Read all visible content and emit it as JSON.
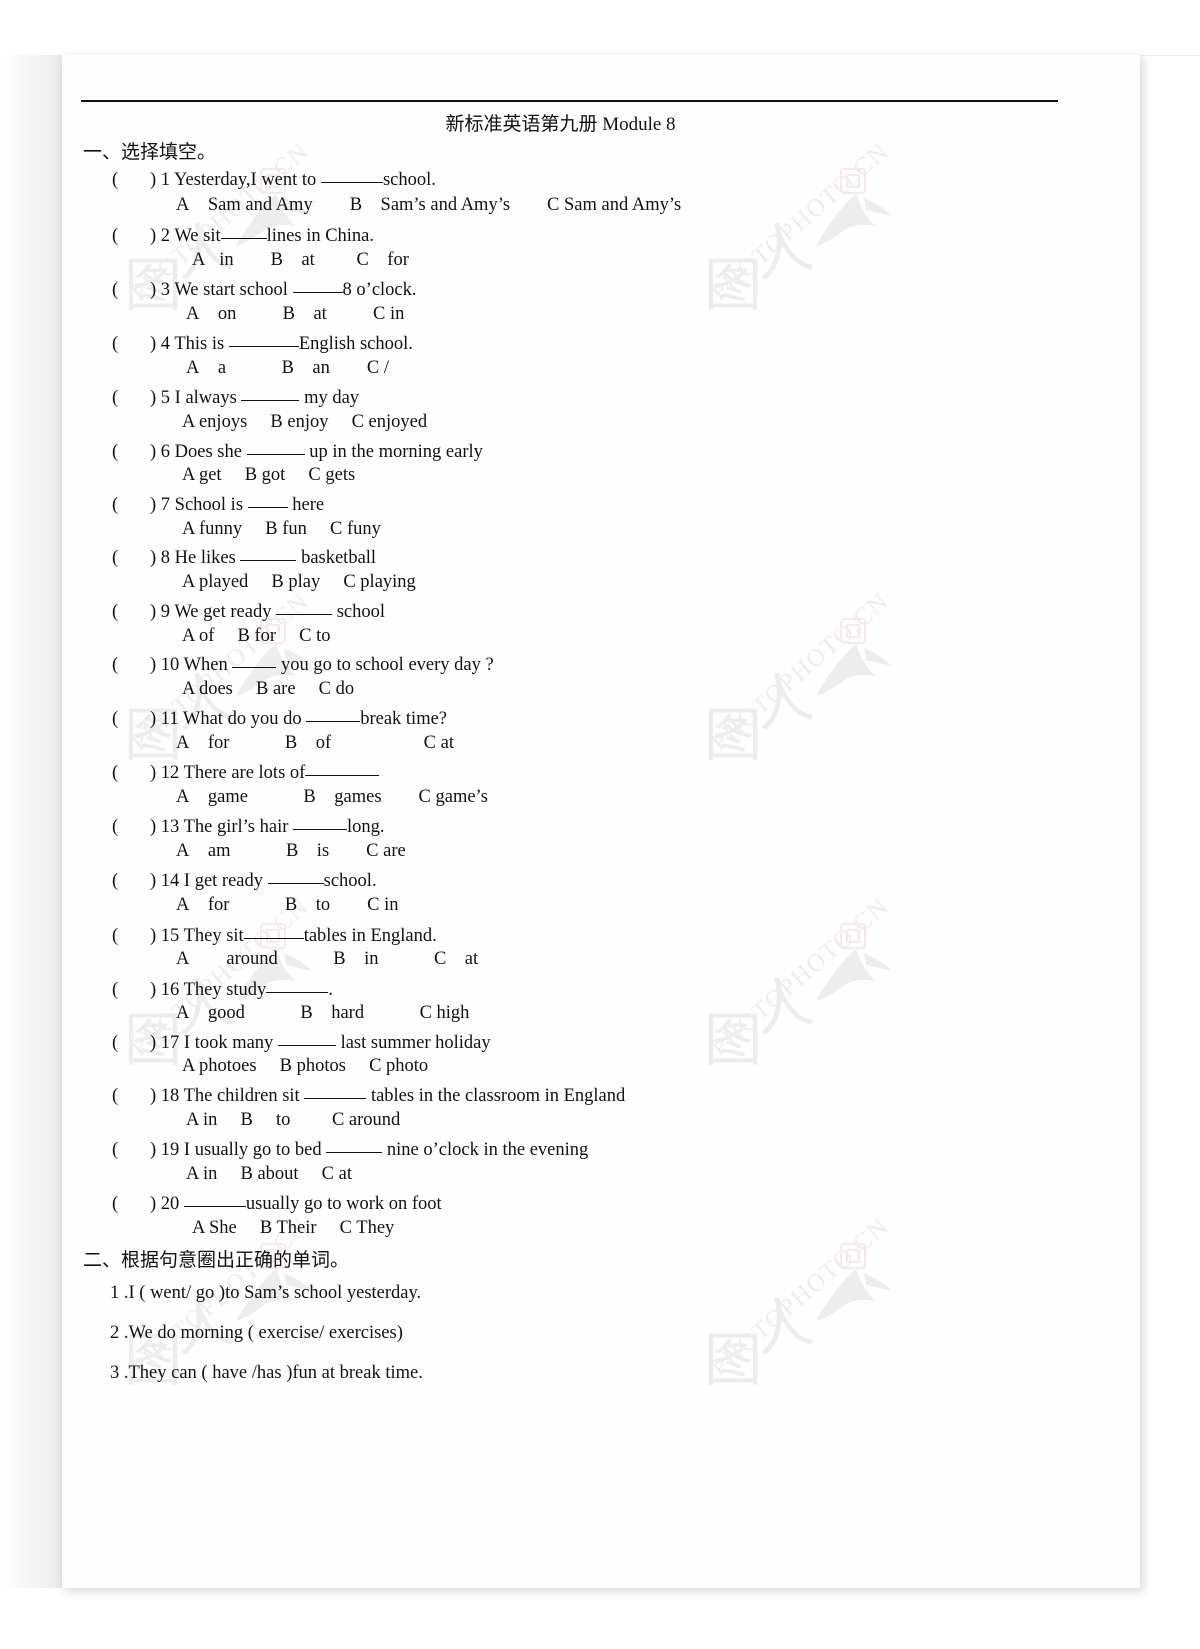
{
  "document": {
    "title": "新标准英语第九册 Module 8",
    "watermark_text": "PHOTOPHOTO.CN",
    "watermark_glyph_a": "图",
    "watermark_glyph_b": "人"
  },
  "section_one": {
    "heading": "一、选择填空。",
    "questions": [
      {
        "num": "1",
        "text_before": ") 1 Yesterday,I went to ",
        "blank_width": 62,
        "text_after": "school.",
        "options": "A Sam and Amy  B Sam’s and Amy’s  C Sam and Amy’s"
      },
      {
        "num": "2",
        "text_before": ") 2 We sit",
        "blank_width": 46,
        "text_after": "lines in China.",
        "options": "A  in  B at   C for"
      },
      {
        "num": "3",
        "text_before": ") 3 We start school ",
        "blank_width": 50,
        "text_after": "8 o’clock.",
        "options": "A on   B at   C in"
      },
      {
        "num": "4",
        "text_before": ") 4 This is ",
        "blank_width": 70,
        "text_after": "English school.",
        "options": "A a   B an  C /"
      },
      {
        "num": "5",
        "text_before": ") 5 I always ",
        "blank_width": 58,
        "text_after": " my day",
        "options": "A enjoys  B enjoy  C enjoyed"
      },
      {
        "num": "6",
        "text_before": ") 6 Does she ",
        "blank_width": 58,
        "text_after": " up in the morning early",
        "options": "A get  B got  C gets"
      },
      {
        "num": "7",
        "text_before": ") 7 School is ",
        "blank_width": 40,
        "text_after": " here",
        "options": "A funny  B fun  C funy"
      },
      {
        "num": "8",
        "text_before": ") 8 He likes ",
        "blank_width": 56,
        "text_after": " basketball",
        "options": "A played  B play  C playing"
      },
      {
        "num": "9",
        "text_before": ") 9 We get ready ",
        "blank_width": 56,
        "text_after": " school",
        "options": "A of  B for  C to"
      },
      {
        "num": "10",
        "text_before": ") 10 When ",
        "blank_width": 44,
        "text_after": " you go to school every day ?",
        "options": "A does  B are  C do"
      },
      {
        "num": "11",
        "text_before": ") 11 What do you do ",
        "blank_width": 54,
        "text_after": "break time?",
        "options": "A for   B of     C at"
      },
      {
        "num": "12",
        "text_before": ") 12 There are lots of",
        "blank_width": 74,
        "text_after": "",
        "options": "A game   B games  C game’s"
      },
      {
        "num": "13",
        "text_before": ") 13 The girl’s hair ",
        "blank_width": 54,
        "text_after": "long.",
        "options": "A am   B is  C are"
      },
      {
        "num": "14",
        "text_before": ") 14 I get ready ",
        "blank_width": 56,
        "text_after": "school.",
        "options": "A for   B to  C in"
      },
      {
        "num": "15",
        "text_before": ") 15 They sit",
        "blank_width": 60,
        "text_after": "tables in England.",
        "options": "A  around   B in   C at"
      },
      {
        "num": "16",
        "text_before": ") 16 They study",
        "blank_width": 62,
        "text_after": ".",
        "options": "A good   B hard   C high"
      },
      {
        "num": "17",
        "text_before": ") 17 I took many ",
        "blank_width": 58,
        "text_after": " last summer holiday",
        "options": "A photoes  B photos  C photo"
      },
      {
        "num": "18",
        "text_before": ") 18 The children sit ",
        "blank_width": 62,
        "text_after": " tables in the classroom in England",
        "options": "A in  B  to   C around"
      },
      {
        "num": "19",
        "text_before": ") 19 I usually go to bed ",
        "blank_width": 56,
        "text_after": " nine o’clock in the evening",
        "options": "A in  B about  C at"
      },
      {
        "num": "20",
        "text_before": ") 20 ",
        "blank_width": 62,
        "text_after": "usually go to work on foot",
        "options": "A She  B Their  C They"
      }
    ]
  },
  "section_two": {
    "heading": "二、根据句意圈出正确的单词。",
    "items": [
      "1 .I ( went/ go )to Sam’s school yesterday.",
      "2 .We do morning ( exercise/ exercises)",
      "3 .They can ( have /has )fun at break time."
    ]
  }
}
